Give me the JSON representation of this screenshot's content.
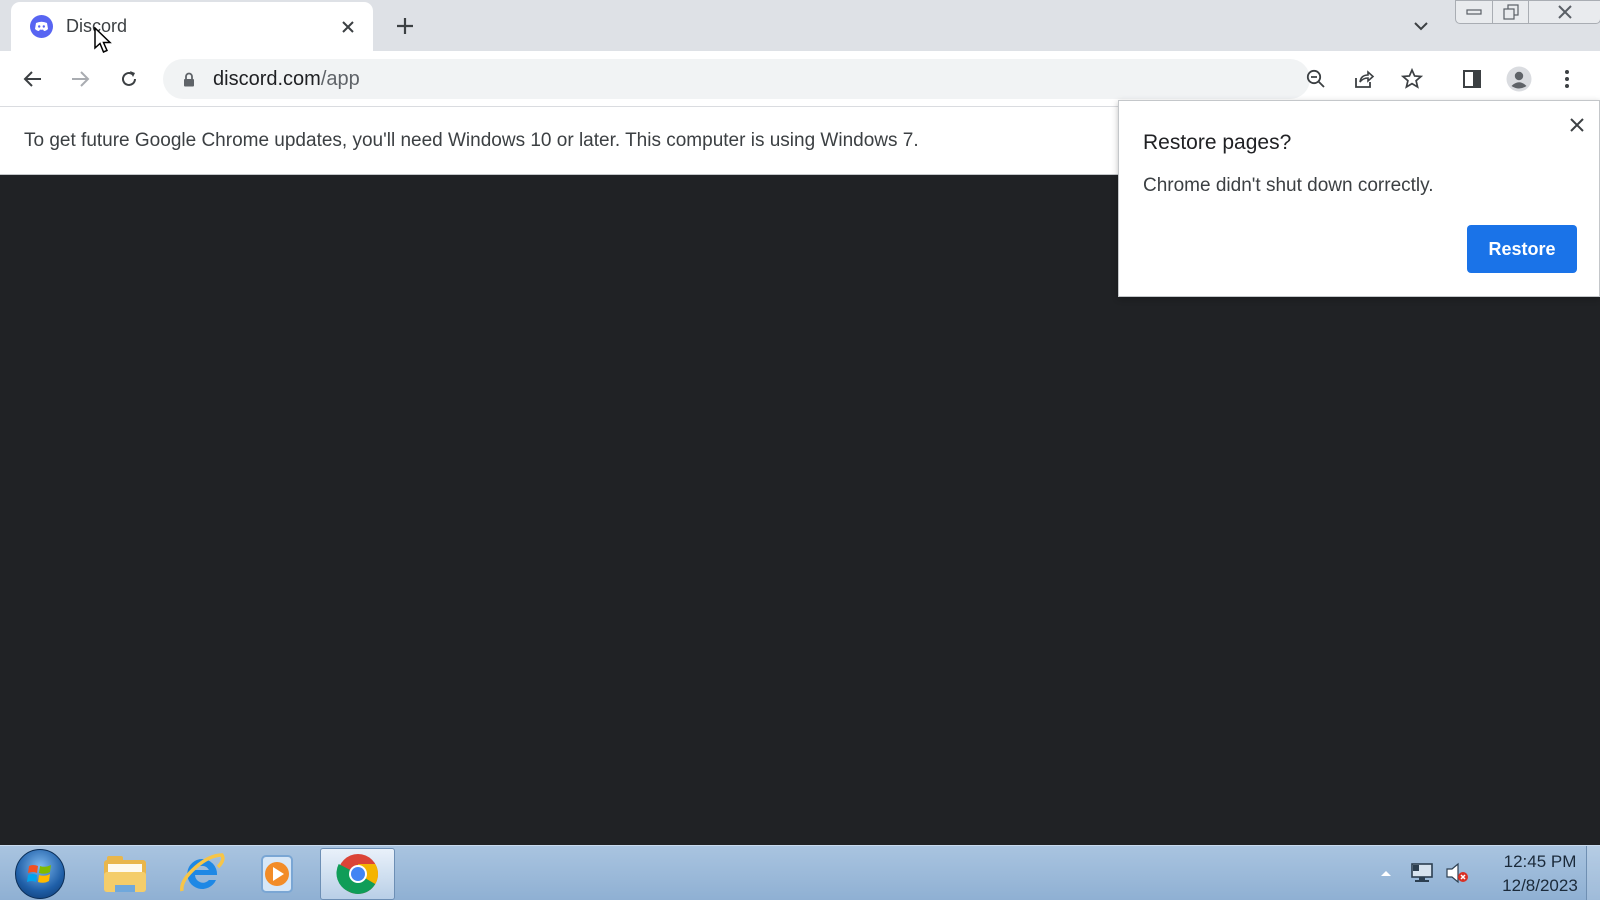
{
  "browser": {
    "tab": {
      "title": "Discord",
      "favicon": "discord-icon"
    },
    "address_bar": {
      "host": "discord.com",
      "path": "/app"
    },
    "icons": {
      "back": "back-arrow-icon",
      "forward": "forward-arrow-icon",
      "reload": "reload-icon",
      "zoom": "zoom-out-icon",
      "share": "share-icon",
      "bookmark": "star-icon",
      "side_panel": "side-panel-icon",
      "profile": "profile-icon",
      "menu": "kebab-menu-icon"
    }
  },
  "infobar": {
    "message": "To get future Google Chrome updates, you'll need Windows 10 or later. This computer is using Windows 7."
  },
  "restore_bubble": {
    "title": "Restore pages?",
    "body": "Chrome didn't shut down correctly.",
    "button_label": "Restore"
  },
  "taskbar": {
    "apps": [
      "windows-explorer",
      "internet-explorer",
      "windows-media-player",
      "google-chrome"
    ],
    "active_app": "google-chrome",
    "clock": {
      "time": "12:45 PM",
      "date": "12/8/2023"
    }
  },
  "colors": {
    "page_background": "#202225",
    "accent": "#1a73e8",
    "discord_brand": "#5865f2"
  }
}
